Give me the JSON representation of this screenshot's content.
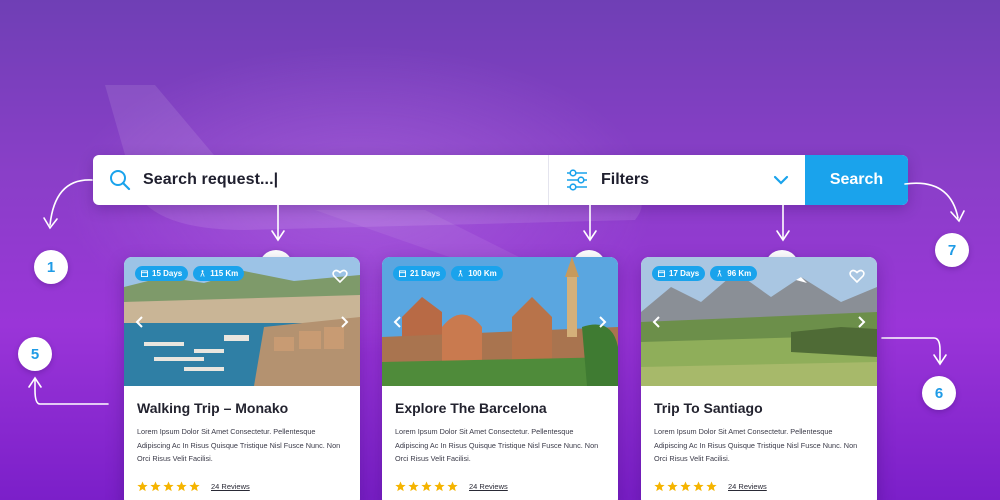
{
  "search": {
    "placeholder": "Search request...|",
    "filters_label": "Filters",
    "button_label": "Search"
  },
  "callouts": [
    "1",
    "2",
    "3",
    "4",
    "5",
    "6",
    "7"
  ],
  "colors": {
    "accent": "#1aa3ec",
    "star": "#f5b400",
    "background": "#8a3fc8"
  },
  "cards": [
    {
      "days": "15 Days",
      "distance": "115 Km",
      "title": "Walking Trip – Monako",
      "description": "Lorem Ipsum Dolor Sit Amet Consectetur. Pellentesque Adipiscing Ac In Risus Quisque Tristique Nisl Fusce Nunc. Non Orci Risus Velit Facilisi.",
      "rating": 5,
      "reviews": "24 Reviews"
    },
    {
      "days": "21 Days",
      "distance": "100 Km",
      "title": "Explore The Barcelona",
      "description": "Lorem Ipsum Dolor Sit Amet Consectetur. Pellentesque Adipiscing Ac In Risus Quisque Tristique Nisl Fusce Nunc. Non Orci Risus Velit Facilisi.",
      "rating": 5,
      "reviews": "24 Reviews"
    },
    {
      "days": "17 Days",
      "distance": "96 Km",
      "title": "Trip To Santiago",
      "description": "Lorem Ipsum Dolor Sit Amet Consectetur. Pellentesque Adipiscing Ac In Risus Quisque Tristique Nisl Fusce Nunc. Non Orci Risus Velit Facilisi.",
      "rating": 5,
      "reviews": "24 Reviews"
    }
  ]
}
